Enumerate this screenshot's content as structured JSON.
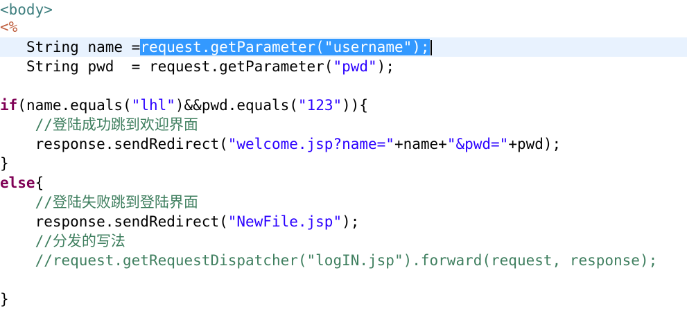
{
  "code": {
    "body_open_tag": "<body>",
    "scriptlet_open": "<%",
    "line3": {
      "indent": "   ",
      "decl": "String name =",
      "selected": "request.getParameter(\"username\");"
    },
    "line4": {
      "indent": "   ",
      "decl": "String pwd  = request.getParameter(",
      "arg": "\"pwd\"",
      "end": ");"
    },
    "line6": {
      "keyword": "if",
      "part1": "(name.equals(",
      "str1": "\"lhl\"",
      "part2": ")&&pwd.equals(",
      "str2": "\"123\"",
      "part3": ")){"
    },
    "line7": {
      "indent": "    ",
      "comment": "//登陆成功跳到欢迎界面"
    },
    "line8": {
      "indent": "    ",
      "part1": "response.sendRedirect(",
      "str1": "\"welcome.jsp?name=\"",
      "part2": "+name+",
      "str2": "\"&pwd=\"",
      "part3": "+pwd);"
    },
    "line9": "}",
    "line10": {
      "keyword": "else",
      "brace": "{"
    },
    "line11": {
      "indent": "    ",
      "comment": "//登陆失败跳到登陆界面"
    },
    "line12": {
      "indent": "    ",
      "part1": "response.sendRedirect(",
      "str1": "\"NewFile.jsp\"",
      "part2": ");"
    },
    "line13": {
      "indent": "    ",
      "comment": "//分发的写法"
    },
    "line14": {
      "indent": "    ",
      "comment": "//request.getRequestDispatcher(\"logIN.jsp\").forward(request, response);"
    },
    "line16": "}"
  },
  "colors": {
    "tag": "#3f7f7f",
    "jsp_delimiter": "#bf5f3f",
    "keyword": "#7f0055",
    "string": "#2a00ff",
    "comment": "#3f7f5f",
    "selection": "#3399ff",
    "current_line": "#e8f2fe"
  }
}
